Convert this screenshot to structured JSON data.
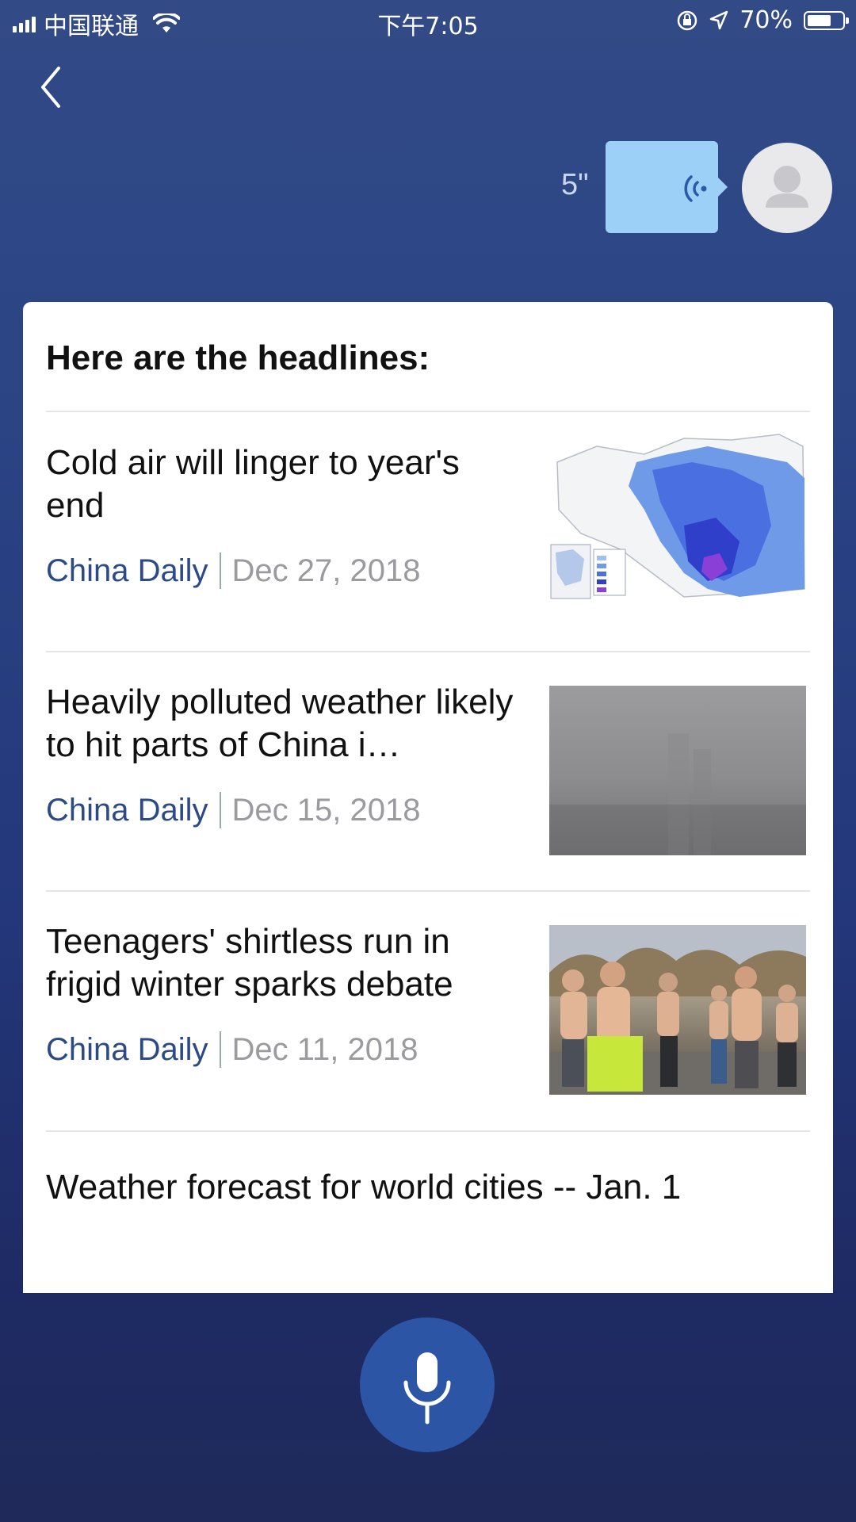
{
  "status_bar": {
    "carrier": "中国联通",
    "time": "下午7:05",
    "battery": "70%",
    "battery_level": 0.7,
    "icons": [
      "signal-icon",
      "wifi-icon",
      "orientation-lock-icon",
      "location-icon",
      "battery-icon"
    ]
  },
  "nav": {
    "back_icon": "chevron-left-icon"
  },
  "voice_message": {
    "duration": "5\"",
    "icon": "voice-wave-icon",
    "bubble_color": "#9dd0f7"
  },
  "avatar": {
    "icon": "user-icon"
  },
  "card": {
    "title": "Here are the headlines:",
    "items": [
      {
        "title": "Cold air will linger to year's end",
        "source": "China Daily",
        "date": "Dec 27, 2018",
        "thumb": "weather-map-image"
      },
      {
        "title": "Heavily polluted weather likely to hit parts of China i…",
        "source": "China Daily",
        "date": "Dec 15, 2018",
        "thumb": "smog-image"
      },
      {
        "title": "Teenagers' shirtless run in frigid winter sparks debate",
        "source": "China Daily",
        "date": "Dec 11, 2018",
        "thumb": "runners-image"
      }
    ],
    "last_item_title": "Weather forecast for world cities -- Jan. 1"
  },
  "mic": {
    "icon": "microphone-icon",
    "color": "#2c55a6"
  },
  "colors": {
    "background_top": "#324a86",
    "background_bottom": "#1f2a5a",
    "source_text": "#2b4a86",
    "date_text": "#9a9a9f"
  }
}
